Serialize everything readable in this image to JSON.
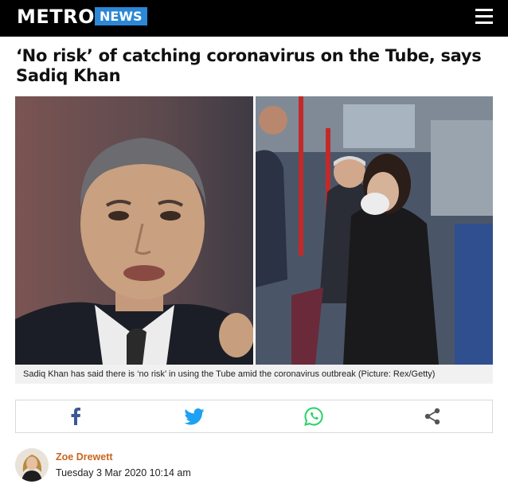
{
  "header": {
    "logo_text": "METRO",
    "section_label": "NEWS",
    "menu_icon": "hamburger-menu-icon",
    "background_color": "#000000",
    "badge_color": "#2c87d6"
  },
  "article": {
    "headline": "‘No risk’ of catching coronavirus on the Tube, says Sadiq Khan",
    "caption": "Sadiq Khan has said there is ‘no risk’ in using the Tube amid the coronavirus outbreak (Picture: Rex/Getty)"
  },
  "share": {
    "buttons": [
      {
        "icon": "facebook-icon",
        "color": "#3b5998"
      },
      {
        "icon": "twitter-icon",
        "color": "#1da1f2"
      },
      {
        "icon": "whatsapp-icon",
        "color": "#25d366"
      },
      {
        "icon": "share-icon",
        "color": "#555555"
      }
    ]
  },
  "byline": {
    "author": "Zoe Drewett",
    "date": "Tuesday 3 Mar 2020 10:14 am",
    "author_color": "#c8661f"
  }
}
